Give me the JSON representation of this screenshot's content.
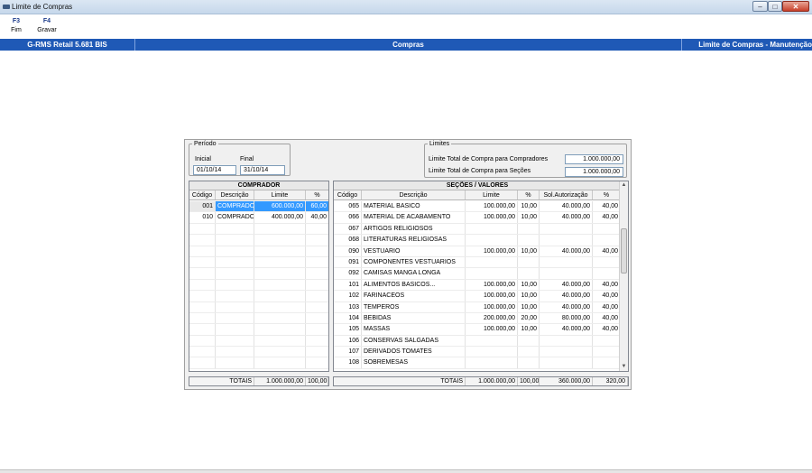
{
  "window": {
    "title": "Limite de Compras"
  },
  "toolbar": {
    "keys": [
      {
        "key": "F3",
        "label": "Fim"
      },
      {
        "key": "F4",
        "label": "Gravar"
      }
    ]
  },
  "statusbar": {
    "app": "G-RMS Retail 5.681 BIS",
    "module": "Compras",
    "screen": "Limite de Compras - Manutenção"
  },
  "periodo": {
    "legend": "Período",
    "inicial_label": "Inicial",
    "inicial_value": "01/10/14",
    "final_label": "Final",
    "final_value": "31/10/14"
  },
  "limites": {
    "legend": "Limites",
    "compradores_label": "Limite Total de Compra para Compradores",
    "compradores_value": "1.000.000,00",
    "secoes_label": "Limite Total de Compra para Seções",
    "secoes_value": "1.000.000,00"
  },
  "comprador": {
    "title": "COMPRADOR",
    "columns": [
      "Código",
      "Descrição",
      "Limite",
      "%"
    ],
    "rows": [
      {
        "codigo": "001",
        "descricao": "COMPRADOR",
        "limite": "600.000,00",
        "pct": "60,00",
        "selected": true
      },
      {
        "codigo": "010",
        "descricao": "COMPRADOR",
        "limite": "400.000,00",
        "pct": "40,00",
        "selected": false
      }
    ],
    "totals": {
      "label": "TOTAIS",
      "limite": "1.000.000,00",
      "pct": "100,00"
    }
  },
  "secoes": {
    "title": "SEÇÕES / VALORES",
    "columns": [
      "Código",
      "Descrição",
      "Limite",
      "%",
      "Sol.Autorização",
      "%"
    ],
    "rows": [
      {
        "codigo": "065",
        "descricao": "MATERIAL BASICO",
        "limite": "100.000,00",
        "pct": "10,00",
        "sol": "40.000,00",
        "pct2": "40,00"
      },
      {
        "codigo": "066",
        "descricao": "MATERIAL DE ACABAMENTO",
        "limite": "100.000,00",
        "pct": "10,00",
        "sol": "40.000,00",
        "pct2": "40,00"
      },
      {
        "codigo": "067",
        "descricao": "ARTIGOS RELIGIOSOS",
        "limite": "",
        "pct": "",
        "sol": "",
        "pct2": ""
      },
      {
        "codigo": "068",
        "descricao": "LITERATURAS RELIGIOSAS",
        "limite": "",
        "pct": "",
        "sol": "",
        "pct2": ""
      },
      {
        "codigo": "090",
        "descricao": "VESTUARIO",
        "limite": "100.000,00",
        "pct": "10,00",
        "sol": "40.000,00",
        "pct2": "40,00"
      },
      {
        "codigo": "091",
        "descricao": "COMPONENTES VESTUARIOS",
        "limite": "",
        "pct": "",
        "sol": "",
        "pct2": ""
      },
      {
        "codigo": "092",
        "descricao": "CAMISAS MANGA LONGA",
        "limite": "",
        "pct": "",
        "sol": "",
        "pct2": ""
      },
      {
        "codigo": "101",
        "descricao": "ALIMENTOS BASICOS...",
        "limite": "100.000,00",
        "pct": "10,00",
        "sol": "40.000,00",
        "pct2": "40,00"
      },
      {
        "codigo": "102",
        "descricao": "FARINACEOS",
        "limite": "100.000,00",
        "pct": "10,00",
        "sol": "40.000,00",
        "pct2": "40,00"
      },
      {
        "codigo": "103",
        "descricao": "TEMPEROS",
        "limite": "100.000,00",
        "pct": "10,00",
        "sol": "40.000,00",
        "pct2": "40,00"
      },
      {
        "codigo": "104",
        "descricao": "BEBIDAS",
        "limite": "200.000,00",
        "pct": "20,00",
        "sol": "80.000,00",
        "pct2": "40,00"
      },
      {
        "codigo": "105",
        "descricao": "MASSAS",
        "limite": "100.000,00",
        "pct": "10,00",
        "sol": "40.000,00",
        "pct2": "40,00"
      },
      {
        "codigo": "106",
        "descricao": "CONSERVAS SALGADAS",
        "limite": "",
        "pct": "",
        "sol": "",
        "pct2": ""
      },
      {
        "codigo": "107",
        "descricao": "DERIVADOS TOMATES",
        "limite": "",
        "pct": "",
        "sol": "",
        "pct2": ""
      },
      {
        "codigo": "108",
        "descricao": "SOBREMESAS",
        "limite": "",
        "pct": "",
        "sol": "",
        "pct2": ""
      }
    ],
    "totals": {
      "label": "TOTAIS",
      "limite": "1.000.000,00",
      "pct": "100,00",
      "sol": "360.000,00",
      "pct2": "320,00"
    }
  },
  "icons": {
    "app": "app-icon",
    "minimize": "minimize-icon",
    "maximize": "maximize-icon",
    "close": "close-icon",
    "scroll_up": "scroll-up-icon",
    "scroll_down": "scroll-down-icon"
  },
  "colors": {
    "statusbar": "#1f59b6",
    "selection": "#3399ff",
    "fkey": "#1b3a8a"
  }
}
